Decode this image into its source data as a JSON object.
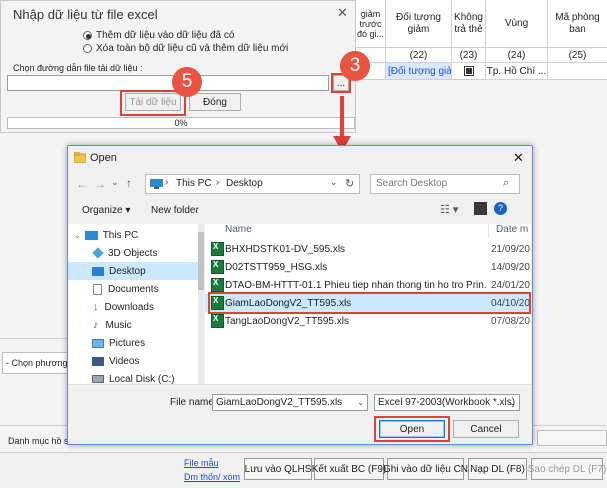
{
  "grid": {
    "headers": [
      "giảm\ntrước\nđó\ngi...",
      "Đối tượng giảm",
      "Không\ntrả thẻ",
      "Vùng",
      "Mã phòng\nban"
    ],
    "numbers": [
      "",
      "(22)",
      "(23)",
      "(24)",
      "(25)"
    ],
    "row": [
      "",
      "[Đối tượng giảm]",
      "",
      "Tp. Hồ Chí ...",
      ""
    ]
  },
  "import_dialog": {
    "title": "Nhập dữ liệu từ file excel",
    "close": "✕",
    "option_append": "Thêm dữ liệu vào dữ liệu đã có",
    "option_replace": "Xóa toàn bộ dữ liệu cũ và thêm dữ liệu mới",
    "path_label": "Chọn đường dẫn file tải dữ liệu :",
    "browse": "...",
    "load_button": "Tải dữ liệu",
    "close_button": "Đóng",
    "progress": "0%",
    "progress_value": 0
  },
  "callouts": [
    "5",
    "3",
    "4"
  ],
  "background_labels": {
    "method": "- Chọn phương á",
    "catalog": "Danh mục hồ sơ",
    "link_template": "File mẫu",
    "link_guide": "Dm thốn/ xóm"
  },
  "bottom_buttons": [
    "Lưu vào QLHS",
    "Kết xuất BC (F9)",
    "Ghi vào dữ liệu CN",
    "Nạp DL (F8)",
    "Sao chép DL (F7)"
  ],
  "open_dialog": {
    "title": "Open",
    "breadcrumb": [
      "This PC",
      "Desktop"
    ],
    "search_placeholder": "Search Desktop",
    "organize": "Organize ▾",
    "new_folder": "New folder",
    "col_name": "Name",
    "col_date": "Date m",
    "nav": [
      {
        "label": "This PC",
        "icon": "pc-icon",
        "selected": false
      },
      {
        "label": "3D Objects",
        "icon": "cube-icon",
        "selected": false
      },
      {
        "label": "Desktop",
        "icon": "desktop-icon",
        "selected": true
      },
      {
        "label": "Documents",
        "icon": "document-icon",
        "selected": false
      },
      {
        "label": "Downloads",
        "icon": "download-icon",
        "selected": false
      },
      {
        "label": "Music",
        "icon": "music-icon",
        "selected": false
      },
      {
        "label": "Pictures",
        "icon": "picture-icon",
        "selected": false
      },
      {
        "label": "Videos",
        "icon": "video-icon",
        "selected": false
      },
      {
        "label": "Local Disk (C:)",
        "icon": "disk-icon",
        "selected": false
      }
    ],
    "files": [
      {
        "name": "BHXHDSTK01-DV_595.xls",
        "date": "21/09/20",
        "selected": false
      },
      {
        "name": "D02TSTT959_HSG.xls",
        "date": "14/09/20",
        "selected": false
      },
      {
        "name": "DTAO-BM-HTTT-01.1 Phieu tiep nhan thong tin ho tro Prin...",
        "date": "24/01/20",
        "selected": false
      },
      {
        "name": "GiamLaoDongV2_TT595.xls",
        "date": "04/10/20",
        "selected": true
      },
      {
        "name": "TangLaoDongV2_TT595.xls",
        "date": "07/08/20",
        "selected": false
      }
    ],
    "file_name_label": "File name:",
    "file_name_value": "GiamLaoDongV2_TT595.xls",
    "file_type": "Excel 97-2003(Workbook *.xls)",
    "open_button": "Open",
    "cancel_button": "Cancel",
    "close": "✕"
  },
  "colors": {
    "callout": "#e9533f",
    "highlight": "#e0403a",
    "selection": "#cce8ff",
    "accent": "#0078d7"
  }
}
